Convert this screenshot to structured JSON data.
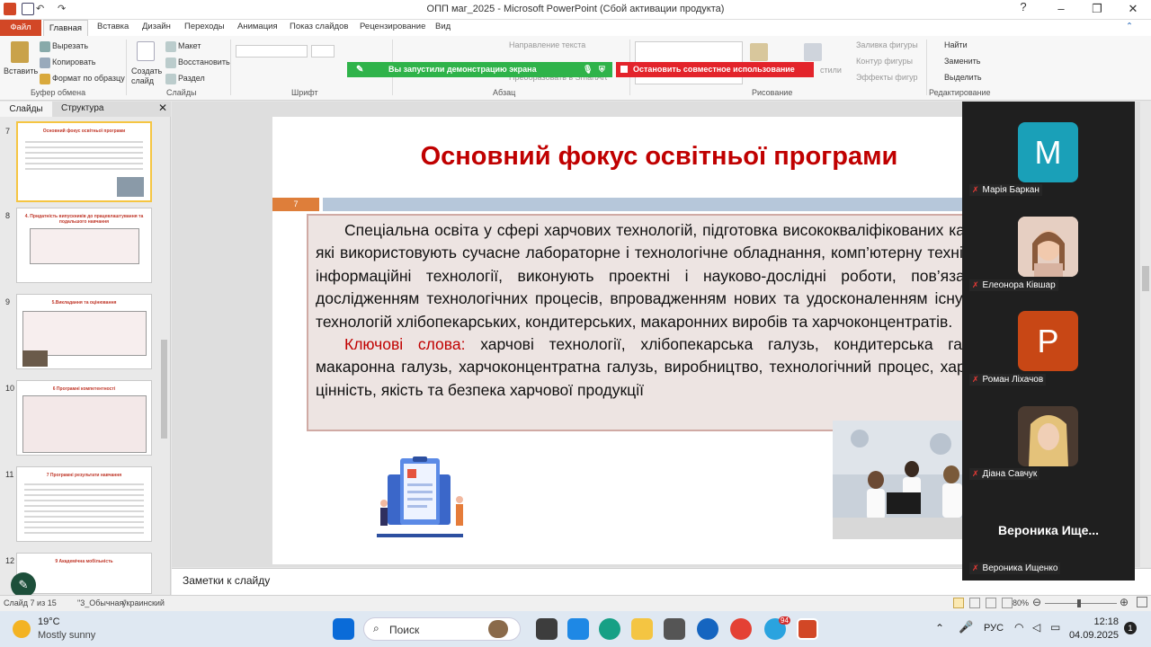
{
  "window": {
    "title": "ОПП маг_2025 - Microsoft PowerPoint (Сбой активации продукта)"
  },
  "ribbon_tabs": {
    "file": "Файл",
    "home": "Главная",
    "insert": "Вставка",
    "design": "Дизайн",
    "transitions": "Переходы",
    "animation": "Анимация",
    "slideshow": "Показ слайдов",
    "review": "Рецензирование",
    "view": "Вид"
  },
  "ribbon": {
    "paste": "Вставить",
    "cut": "Вырезать",
    "copy": "Копировать",
    "format_painter": "Формат по образцу",
    "clipboard_group": "Буфер обмена",
    "new_slide": "Создать слайд",
    "layout": "Макет",
    "reset": "Восстановить",
    "section": "Раздел",
    "slides_group": "Слайды",
    "font_group": "Шрифт",
    "text_direction": "Направление текста",
    "convert_smartart": "Преобразовать в SmartArt",
    "paragraph_group": "Абзац",
    "styles": "стили",
    "shape_fill": "Заливка фигуры",
    "shape_outline": "Контур фигуры",
    "shape_effects": "Эффекты фигур",
    "drawing_group": "Рисование",
    "find": "Найти",
    "replace": "Заменить",
    "select": "Выделить",
    "editing_group": "Редактирование"
  },
  "share": {
    "started": "Вы запустили демонстрацию экрана",
    "stop": "Остановить совместное использование"
  },
  "left_pane": {
    "tab_slides": "Слайды",
    "tab_outline": "Структура",
    "thumbnails": [
      {
        "num": "7",
        "title": "Основний фокус освітньої програми"
      },
      {
        "num": "8",
        "title": "4. Придатність випускників до працевлаштування та подальшого навчання"
      },
      {
        "num": "9",
        "title": "5.Викладання та оцінювання"
      },
      {
        "num": "10",
        "title": "6 Програмні компетентності"
      },
      {
        "num": "11",
        "title": "7 Програмні результати навчання"
      },
      {
        "num": "12",
        "title": "9 Академічна мобільність"
      }
    ]
  },
  "slide": {
    "title": "Основний фокус освітньої програми",
    "number": "7",
    "paragraph1": "Спеціальна освіта у сфері харчових технологій, підготовка висококваліфікованих кадрів, які використовують сучасне лабораторне і технологічне обладнання, комп’ютерну техніку та інформаційні технології, виконують проектні і науково-дослідні роботи, пов’язані з дослідженням технологічних процесів, впровадженням нових та удосконаленням існуючих технологій хлібопекарських, кондитерських, макаронних виробів та харчоконцентратів.",
    "keywords_label": "Ключові слова:",
    "keywords_text": " харчові технології, хлібопекарська галузь, кондитерська галузь, макаронна галузь, харчоконцентратна галузь, виробництво, технологічний процес, харчова цінність, якість та безпека харчової продукції"
  },
  "notes": {
    "placeholder": "Заметки к слайду"
  },
  "status": {
    "slide": "Слайд 7 из 15",
    "theme": "\"3_Обычная\"",
    "language": "украинский",
    "zoom": "80%"
  },
  "meeting": {
    "participants": [
      {
        "initial": "M",
        "name": "Марія Баркан",
        "color": "#1aa0b8"
      },
      {
        "name": "Елеонора Ківшар"
      },
      {
        "initial": "P",
        "name": "Роман Ліхачов",
        "color": "#c84715"
      },
      {
        "name": "Діана Савчук"
      },
      {
        "name": "Вероника Ищенко",
        "display": "Вероника  Ище..."
      }
    ]
  },
  "taskbar": {
    "weather_temp": "19°C",
    "weather_desc": "Mostly sunny",
    "search": "Поиск",
    "lang": "РУС",
    "time": "12:18",
    "date": "04.09.2025",
    "notifications": "1",
    "telegram_badge": "94"
  }
}
